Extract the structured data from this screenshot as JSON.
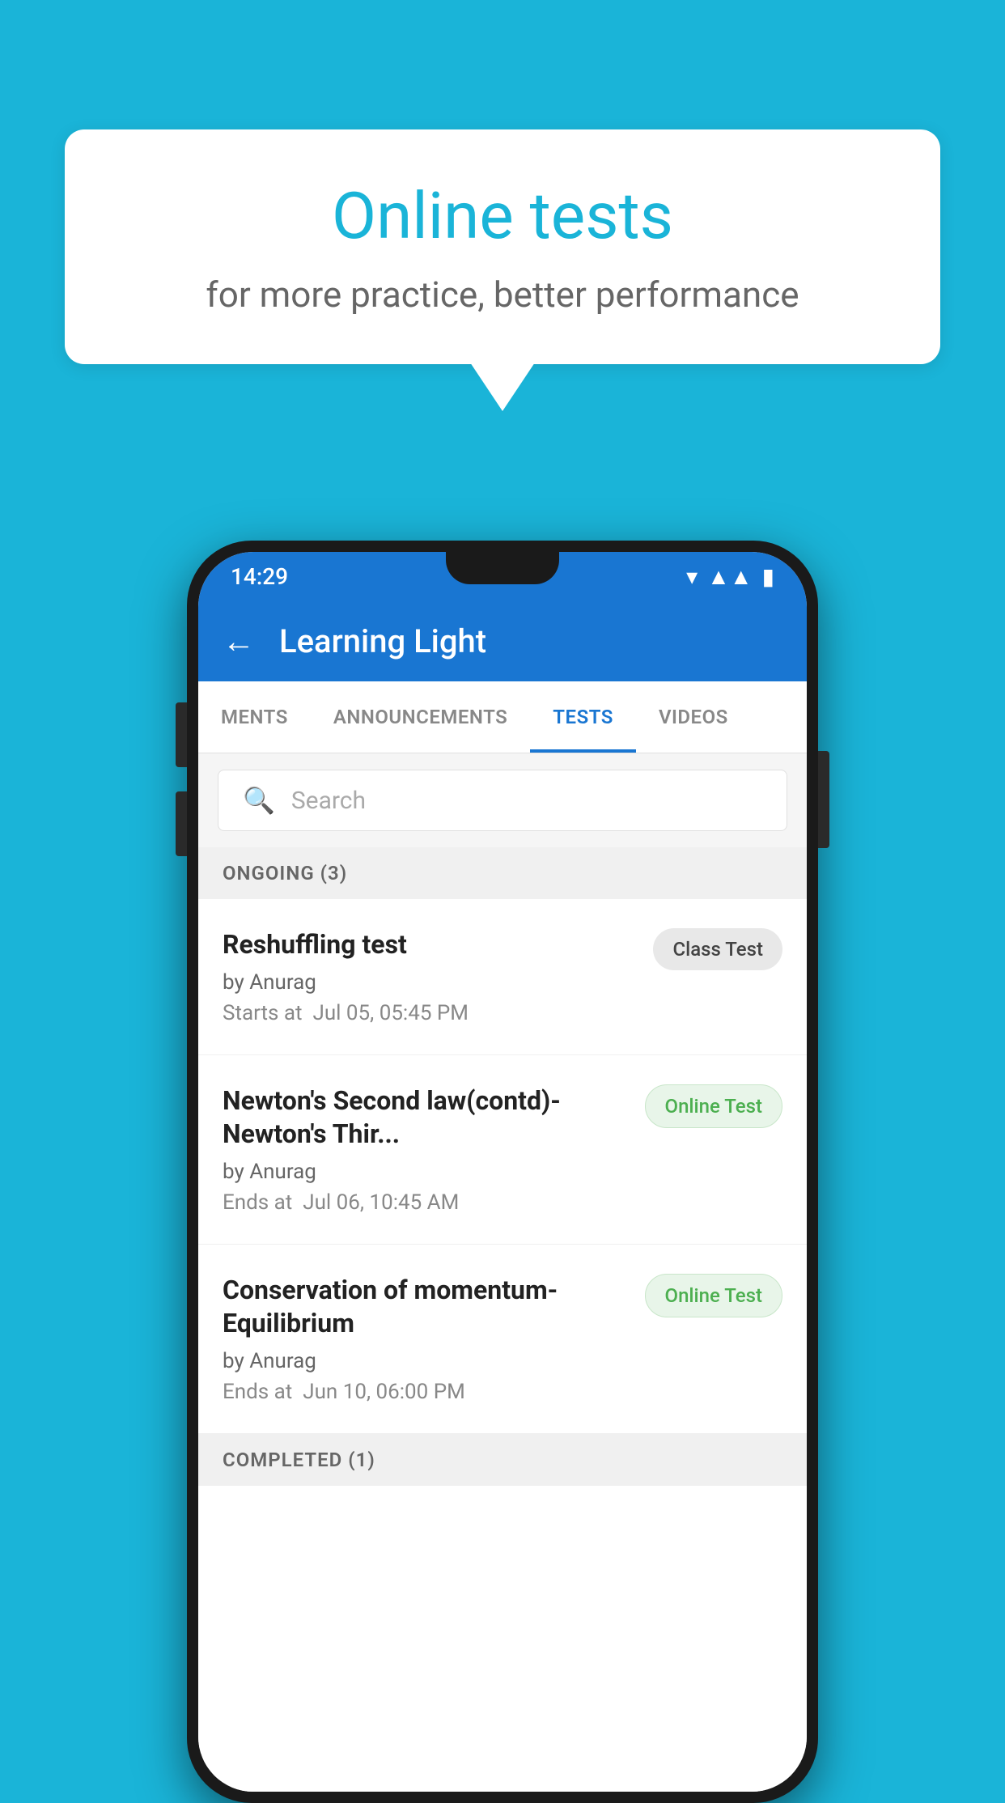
{
  "background_color": "#1ab4d8",
  "speech_bubble": {
    "title": "Online tests",
    "subtitle": "for more practice, better performance"
  },
  "phone": {
    "status_bar": {
      "time": "14:29",
      "wifi": "▼",
      "signal": "▲",
      "battery": "▮"
    },
    "app_bar": {
      "title": "Learning Light",
      "back_label": "←"
    },
    "tabs": [
      {
        "label": "MENTS",
        "active": false
      },
      {
        "label": "ANNOUNCEMENTS",
        "active": false
      },
      {
        "label": "TESTS",
        "active": true
      },
      {
        "label": "VIDEOS",
        "active": false
      }
    ],
    "search": {
      "placeholder": "Search"
    },
    "ongoing_section": {
      "label": "ONGOING (3)"
    },
    "tests": [
      {
        "title": "Reshuffling test",
        "author": "by Anurag",
        "date_label": "Starts at",
        "date": "Jul 05, 05:45 PM",
        "badge_text": "Class Test",
        "badge_type": "class"
      },
      {
        "title": "Newton's Second law(contd)-Newton's Thir...",
        "author": "by Anurag",
        "date_label": "Ends at",
        "date": "Jul 06, 10:45 AM",
        "badge_text": "Online Test",
        "badge_type": "online"
      },
      {
        "title": "Conservation of momentum-Equilibrium",
        "author": "by Anurag",
        "date_label": "Ends at",
        "date": "Jun 10, 06:00 PM",
        "badge_text": "Online Test",
        "badge_type": "online"
      }
    ],
    "completed_section": {
      "label": "COMPLETED (1)"
    }
  }
}
